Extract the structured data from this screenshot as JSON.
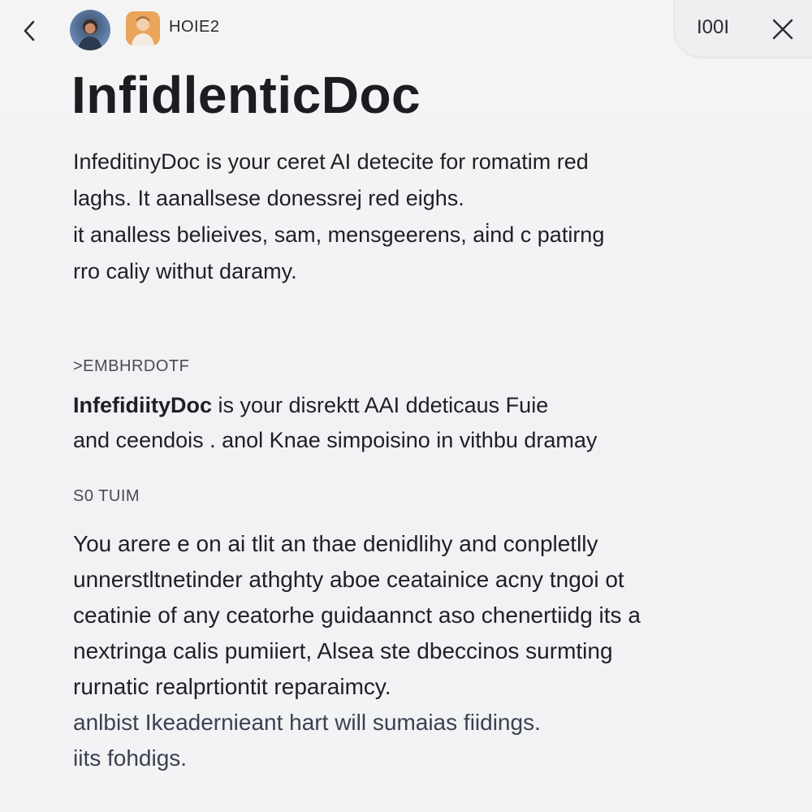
{
  "header": {
    "label": "HOIE2",
    "pill_text": "I00I",
    "icons": [
      "chevron-left-icon",
      "avatar-person-icon",
      "avatar-person-icon",
      "close-icon"
    ]
  },
  "title": "InfidlenticDoc",
  "intro": {
    "lines": [
      "InfeditinyDoc is your ceret AI detecite for romatim red",
      "laghs. It aanallsese donessrej red eighs.",
      "it analless belieives, sam, mensgeerens, ai̇nd c patirng",
      "rro caliy withut daramy."
    ]
  },
  "section_1": {
    "label": ">EMBHRDOTF",
    "brand": "InfefidiityDoc",
    "lines_rest": " is your disrektt AAI ddeticaus Fuie",
    "line_2": "and ceendois . anol Knae simpoisino in vithbu dramay"
  },
  "section_2": {
    "label": "S0 TUIM",
    "lines": [
      "You arere e on ai tlit an thae denidlihy and conpletlly",
      "unnerstltnetinder athghty aboe ceatainice acny tngoi ot",
      "ceatinie of any ceatorhe guidaannct aso chenertiidg its a",
      "nextringa calis pumiiert, Alsea ste dbeccinos surmting",
      "rurnatic realprtiontit reparaimcy.",
      "anlbist Ikeadernieant hart will sumaias fiidings.",
      "iits fohdigs."
    ]
  },
  "colors": {
    "background": "#f3f3f4",
    "text": "#1d1d22",
    "muted": "#4a4a52"
  }
}
